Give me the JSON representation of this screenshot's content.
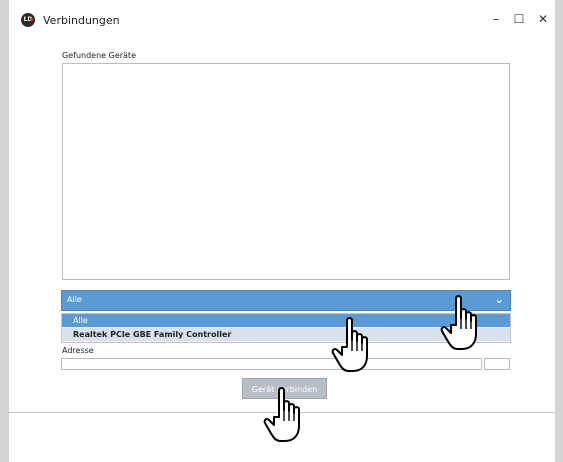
{
  "window": {
    "title": "Verbindungen",
    "app_icon_text": "LD",
    "controls": {
      "minimize": "–",
      "maximize": "☐",
      "close": "✕"
    }
  },
  "devices": {
    "label": "Gefundene Geräte",
    "items": []
  },
  "interface_select": {
    "selected": "Alle",
    "arrow": "⌄",
    "options": [
      "Alle",
      "Realtek PCIe GBE Family Controller"
    ]
  },
  "address": {
    "label": "Adresse",
    "value": "",
    "port_value": ""
  },
  "connect_button": {
    "label": "Gerät verbinden"
  },
  "overlay_icons": [
    "hand-pointer-icon",
    "hand-pointer-icon",
    "hand-pointer-icon"
  ],
  "colors": {
    "accent": "#5b9bd5",
    "selected_option": "#5b9bd5",
    "second_option": "#d9e1ec",
    "button": "#b8bec8",
    "screen_edge": "#d4d4d4"
  }
}
